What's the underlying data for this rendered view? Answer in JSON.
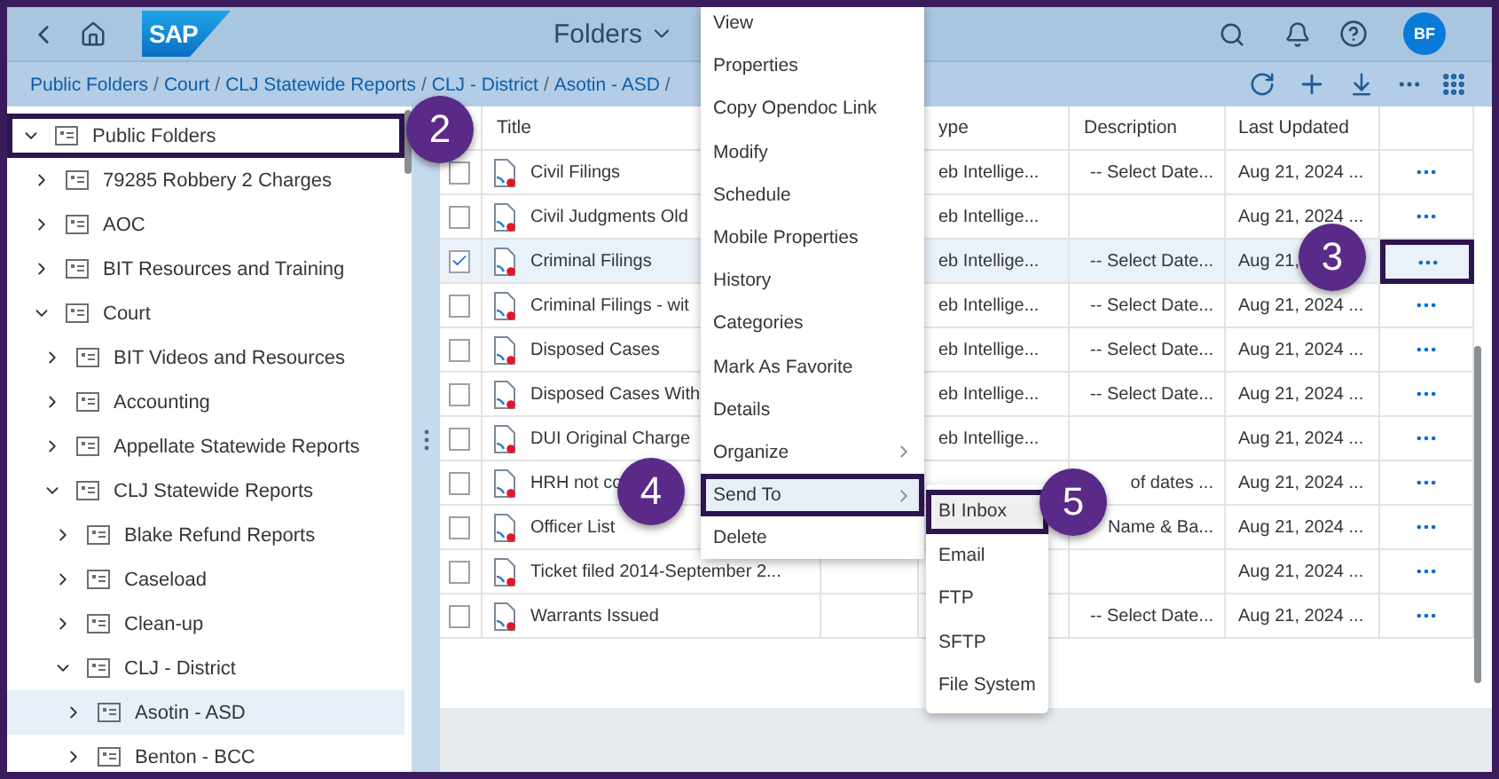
{
  "header": {
    "logo": "SAP",
    "title": "Folders",
    "avatar": "BF"
  },
  "breadcrumbs": {
    "separator": "/",
    "items": [
      "Public Folders",
      "Court",
      "CLJ Statewide Reports",
      "CLJ - District",
      "Asotin - ASD"
    ]
  },
  "tree": [
    {
      "label": "Public Folders",
      "expanded": true,
      "selected": false,
      "callout": "2",
      "children": [
        {
          "label": "79285 Robbery 2 Charges",
          "expanded": false,
          "selected": false
        },
        {
          "label": "AOC",
          "expanded": false,
          "selected": false
        },
        {
          "label": "BIT Resources and Training",
          "expanded": false,
          "selected": false
        },
        {
          "label": "Court",
          "expanded": true,
          "selected": false,
          "children": [
            {
              "label": "BIT Videos and Resources",
              "expanded": false,
              "selected": false
            },
            {
              "label": "Accounting",
              "expanded": false,
              "selected": false
            },
            {
              "label": "Appellate Statewide Reports",
              "expanded": false,
              "selected": false
            },
            {
              "label": "CLJ Statewide Reports",
              "expanded": true,
              "selected": false,
              "children": [
                {
                  "label": "Blake Refund Reports",
                  "expanded": false,
                  "selected": false
                },
                {
                  "label": "Caseload",
                  "expanded": false,
                  "selected": false
                },
                {
                  "label": "Clean-up",
                  "expanded": false,
                  "selected": false
                },
                {
                  "label": "CLJ - District",
                  "expanded": true,
                  "selected": false,
                  "children": [
                    {
                      "label": "Asotin - ASD",
                      "expanded": false,
                      "selected": true
                    },
                    {
                      "label": "Benton - BCC",
                      "expanded": false,
                      "selected": false
                    }
                  ]
                }
              ]
            }
          ]
        }
      ]
    }
  ],
  "table": {
    "columns": [
      "Title",
      "ype",
      "Description",
      "Last Updated"
    ],
    "rows": [
      {
        "title": "Civil Filings",
        "type": "eb Intellige...",
        "description": "-- Select Date...",
        "last_updated": "Aug 21, 2024 ...",
        "checked": false
      },
      {
        "title": "Civil Judgments Old",
        "type": "eb Intellige...",
        "last_updated": "Aug 21, 2024 ...",
        "checked": false
      },
      {
        "title": "Criminal Filings",
        "type": "eb Intellige...",
        "description": "-- Select Date...",
        "last_updated": "Aug 21,",
        "checked": true,
        "callout": "3"
      },
      {
        "title": "Criminal Filings - wit",
        "type": "eb Intellige...",
        "description": "-- Select Date...",
        "last_updated": "Aug 21, 2024 ...",
        "checked": false
      },
      {
        "title": "Disposed Cases",
        "type": "eb Intellige...",
        "description": "-- Select Date...",
        "last_updated": "Aug 21, 2024 ...",
        "checked": false
      },
      {
        "title": "Disposed Cases With",
        "type": "eb Intellige...",
        "description": "-- Select Date...",
        "last_updated": "Aug 21, 2024 ...",
        "checked": false
      },
      {
        "title": "DUI Original Charge",
        "type": "eb Intellige...",
        "last_updated": "Aug 21, 2024 ...",
        "checked": false
      },
      {
        "title": "HRH not co",
        "description": "of dates ...",
        "last_updated": "Aug 21, 2024 ...",
        "checked": false
      },
      {
        "title": "Officer List",
        "description": "Name & Ba...",
        "last_updated": "Aug 21, 2024 ...",
        "checked": false
      },
      {
        "title": "Ticket filed 2014-September 2...",
        "last_updated": "Aug 21, 2024 ...",
        "checked": false
      },
      {
        "title": "Warrants Issued",
        "description": "-- Select Date...",
        "last_updated": "Aug 21, 2024 ...",
        "checked": false
      }
    ]
  },
  "context_menu": [
    {
      "label": "View",
      "has_submenu": false,
      "selected": false
    },
    {
      "label": "Properties",
      "has_submenu": false,
      "selected": false
    },
    {
      "label": "Copy Opendoc Link",
      "has_submenu": false,
      "selected": false
    },
    {
      "label": "Modify",
      "has_submenu": false,
      "selected": false
    },
    {
      "label": "Schedule",
      "has_submenu": false,
      "selected": false
    },
    {
      "label": "Mobile Properties",
      "has_submenu": false,
      "selected": false
    },
    {
      "label": "History",
      "has_submenu": false,
      "selected": false
    },
    {
      "label": "Categories",
      "has_submenu": false,
      "selected": false
    },
    {
      "label": "Mark As Favorite",
      "has_submenu": false,
      "selected": false
    },
    {
      "label": "Details",
      "has_submenu": false,
      "selected": false
    },
    {
      "label": "Organize",
      "has_submenu": true,
      "selected": false
    },
    {
      "label": "Send To",
      "has_submenu": true,
      "selected": true,
      "callout": "4"
    },
    {
      "label": "Delete",
      "has_submenu": false,
      "selected": false
    }
  ],
  "submenu": [
    {
      "label": "BI Inbox",
      "selected": true,
      "callout": "5"
    },
    {
      "label": "Email",
      "selected": false
    },
    {
      "label": "FTP",
      "selected": false
    },
    {
      "label": "SFTP",
      "selected": false
    },
    {
      "label": "File System",
      "selected": false
    }
  ]
}
